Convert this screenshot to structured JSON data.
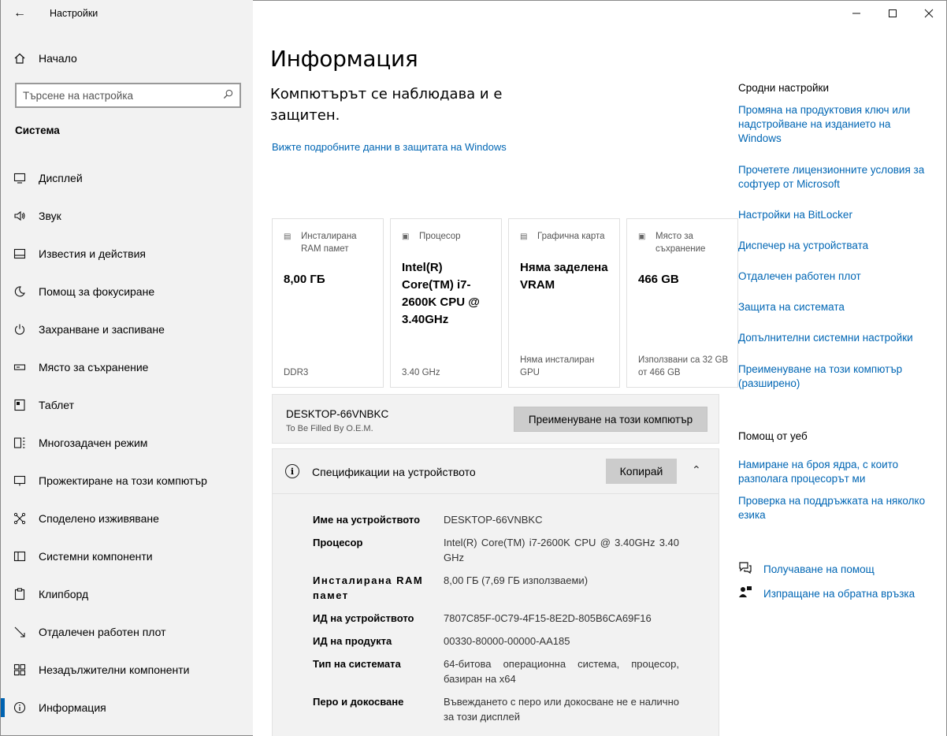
{
  "window": {
    "title": "Настройки"
  },
  "sidebar": {
    "home_label": "Начало",
    "search_placeholder": "Търсене на настройка",
    "section_title": "Система",
    "items": [
      {
        "label": "Дисплей",
        "icon": "display-icon"
      },
      {
        "label": "Звук",
        "icon": "sound-icon"
      },
      {
        "label": "Известия и действия",
        "icon": "notifications-icon"
      },
      {
        "label": "Помощ за фокусиране",
        "icon": "moon-icon"
      },
      {
        "label": "Захранване и заспиване",
        "icon": "power-icon"
      },
      {
        "label": "Място за съхранение",
        "icon": "storage-icon"
      },
      {
        "label": "Таблет",
        "icon": "tablet-icon"
      },
      {
        "label": "Многозадачен режим",
        "icon": "multitask-icon"
      },
      {
        "label": "Прожектиране на този компютър",
        "icon": "project-icon"
      },
      {
        "label": "Споделено изживяване",
        "icon": "shared-icon"
      },
      {
        "label": "Системни компоненти",
        "icon": "components-icon"
      },
      {
        "label": "Клипборд",
        "icon": "clipboard-icon"
      },
      {
        "label": "Отдалечен работен плот",
        "icon": "remote-icon"
      },
      {
        "label": "Незадължителни компоненти",
        "icon": "optional-icon"
      },
      {
        "label": "Информация",
        "icon": "info-icon",
        "active": true
      }
    ]
  },
  "main": {
    "title": "Информация",
    "protection_text": "Компютърът се наблюдава и е защитен.",
    "protection_link": "Вижте подробните данни в защитата на Windows",
    "cards": [
      {
        "title": "Инсталирана RAM памет",
        "value": "8,00 ГБ",
        "footer": "DDR3",
        "icon": "ram-icon"
      },
      {
        "title": "Процесор",
        "value": "Intel(R) Core(TM) i7-2600K CPU @ 3.40GHz",
        "footer": "3.40 GHz",
        "icon": "cpu-icon"
      },
      {
        "title": "Графична карта",
        "value": "Няма заделена VRAM",
        "footer": "Няма инсталиран GPU",
        "icon": "gpu-icon"
      },
      {
        "title": "Място за съхранение",
        "value": "466 GB",
        "footer": "Използвани са 32 GB от 466 GB",
        "icon": "disk-icon"
      }
    ],
    "device_name": "DESKTOP-66VNBKC",
    "device_sub": "To Be Filled By O.E.M.",
    "rename_button": "Преименуване на този компютър",
    "specs_title": "Спецификации на устройството",
    "copy_button": "Копирай",
    "specs": [
      {
        "k": "Име на устройството",
        "v": "DESKTOP-66VNBKC"
      },
      {
        "k": "Процесор",
        "v": "Intel(R) Core(TM) i7-2600K CPU @ 3.40GHz 3.40 GHz"
      },
      {
        "k": "Инсталирана RAM памет",
        "v": "8,00 ГБ (7,69 ГБ използваеми)"
      },
      {
        "k": "ИД на устройството",
        "v": "7807C85F-0C79-4F15-8E2D-805B6CA69F16"
      },
      {
        "k": "ИД на продукта",
        "v": "00330-80000-00000-AA185"
      },
      {
        "k": "Тип на системата",
        "v": "64-битова операционна система, процесор, базиран на x64"
      },
      {
        "k": "Перо и докосване",
        "v": "Въвеждането с перо или докосване не е налично за този дисплей"
      }
    ]
  },
  "right": {
    "related_title": "Сродни настройки",
    "related_links": [
      "Промяна на продуктовия ключ или надстройване на изданието на Windows",
      "Прочетете лицензионните условия за софтуер от Microsoft",
      "Настройки на BitLocker",
      "Диспечер на устройствата",
      "Отдалечен работен плот",
      "Защита на системата",
      "Допълнителни системни настройки",
      "Преименуване на този компютър (разширено)"
    ],
    "web_title": "Помощ от уеб",
    "web_links": [
      "Намиране на броя ядра, с които разполага процесорът ми",
      "Проверка на поддръжката на няколко езика"
    ],
    "get_help": "Получаване на помощ",
    "feedback": "Изпращане на обратна връзка"
  }
}
